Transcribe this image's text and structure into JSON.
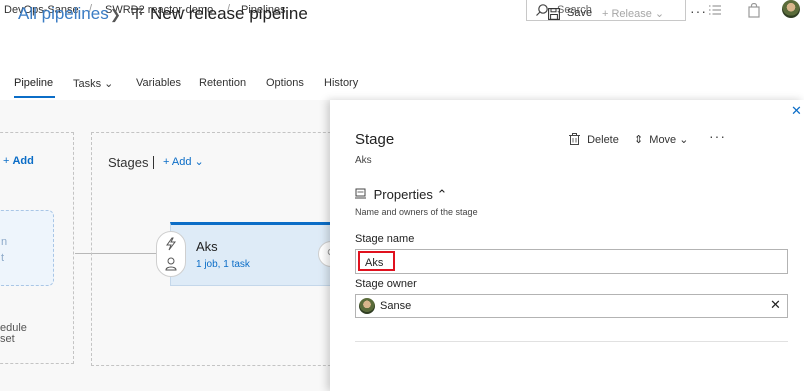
{
  "breadcrumb": {
    "org": "DevOps-Sanse",
    "project": "SWRD2 reactor-demo",
    "section": "Pipelines",
    "separator": "/"
  },
  "search": {
    "placeholder": "Search"
  },
  "header": {
    "back_link": "All pipelines",
    "title": "New release pipeline",
    "save_label": "Save",
    "release_label": "Release",
    "more_label": "···"
  },
  "tabs": [
    {
      "label": "Pipeline",
      "active": true
    },
    {
      "label": "Tasks"
    },
    {
      "label": "Variables"
    },
    {
      "label": "Retention"
    },
    {
      "label": "Options"
    },
    {
      "label": "History"
    }
  ],
  "artifacts": {
    "add_label": "Add",
    "card_line1": "n",
    "card_line2": "t",
    "schedule_line1": "edule",
    "schedule_line2": "set"
  },
  "stages": {
    "label": "Stages",
    "add_label": "Add",
    "items": [
      {
        "name": "Aks",
        "summary": "1 job, 1 task"
      }
    ]
  },
  "panel": {
    "title": "Stage",
    "subtitle": "Aks",
    "delete_label": "Delete",
    "move_label": "Move",
    "more_label": "···",
    "close_label": "✕",
    "properties_heading": "Properties",
    "properties_description": "Name and owners of the stage",
    "stage_name_label": "Stage name",
    "stage_name_value": "Aks",
    "stage_owner_label": "Stage owner",
    "stage_owner_value": "Sanse",
    "clear_label": "✕"
  },
  "colors": {
    "accent": "#0b6dc7",
    "highlight": "#e0111e",
    "stage_card": "#deebf7"
  }
}
